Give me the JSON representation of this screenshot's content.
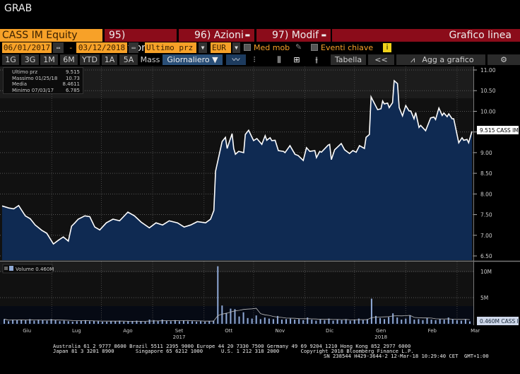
{
  "window_title": "GRAB",
  "toolbar": {
    "security": "CASS IM Equity",
    "compare": "95) Confronto",
    "actions": "96) Azioni",
    "edit": "97) Modif",
    "chart_type": "Grafico linea",
    "start_date": "06/01/2017",
    "date_sep": "-",
    "end_date": "03/12/2018",
    "field": "Ultimo prz",
    "currency": "EUR",
    "moving_avg": "Med mob",
    "key_events": "Eventi chiave",
    "info": "i",
    "periods": [
      "1G",
      "3G",
      "1M",
      "6M",
      "YTD",
      "1A",
      "5A",
      "Mass"
    ],
    "frequency": "Giornaliero ▼",
    "table": "Tabella",
    "collapse": "<<",
    "add_to_chart": "Agg a grafico"
  },
  "legend": {
    "last_label": "Ultimo prz",
    "last_value": "9.515",
    "max_label": "Massimo 01/25/18",
    "max_value": "10.73",
    "avg_label": "Media",
    "avg_value": "8.4611",
    "min_label": "Minimo 07/03/17",
    "min_value": "6.785",
    "volume_label": "Volume 0.460M"
  },
  "chart_data": {
    "type": "area",
    "x_unit": "days since 06/01/2017",
    "xlim": [
      0,
      284
    ],
    "price": {
      "ylim": [
        6.4,
        11.1
      ],
      "ticks": [
        "11.00",
        "10.50",
        "10.00",
        "9.50",
        "9.00",
        "8.50",
        "8.00",
        "7.50",
        "7.00",
        "6.50"
      ],
      "tick_values": [
        11,
        10.5,
        10,
        9.5,
        9,
        8.5,
        8,
        7.5,
        7,
        6.5
      ],
      "last_label": "9.515 CASS IM",
      "points": [
        [
          0,
          7.71
        ],
        [
          4,
          7.66
        ],
        [
          7,
          7.64
        ],
        [
          10,
          7.72
        ],
        [
          14,
          7.47
        ],
        [
          17,
          7.4
        ],
        [
          20,
          7.25
        ],
        [
          24,
          7.12
        ],
        [
          27,
          7.05
        ],
        [
          29,
          6.92
        ],
        [
          31,
          6.79
        ],
        [
          34,
          6.88
        ],
        [
          37,
          6.96
        ],
        [
          40,
          6.86
        ],
        [
          42,
          7.22
        ],
        [
          44,
          7.3
        ],
        [
          46,
          7.39
        ],
        [
          50,
          7.47
        ],
        [
          53,
          7.45
        ],
        [
          56,
          7.2
        ],
        [
          59,
          7.13
        ],
        [
          63,
          7.3
        ],
        [
          67,
          7.39
        ],
        [
          71,
          7.35
        ],
        [
          76,
          7.56
        ],
        [
          80,
          7.47
        ],
        [
          84,
          7.32
        ],
        [
          89,
          7.18
        ],
        [
          93,
          7.3
        ],
        [
          97,
          7.25
        ],
        [
          101,
          7.35
        ],
        [
          106,
          7.3
        ],
        [
          110,
          7.2
        ],
        [
          114,
          7.25
        ],
        [
          118,
          7.33
        ],
        [
          123,
          7.3
        ],
        [
          126,
          7.39
        ],
        [
          128,
          7.6
        ],
        [
          129,
          8.55
        ],
        [
          133,
          9.27
        ],
        [
          135,
          9.37
        ],
        [
          136,
          9.1
        ],
        [
          139,
          9.46
        ],
        [
          140,
          9.1
        ],
        [
          141,
          8.96
        ],
        [
          143,
          9.03
        ],
        [
          146,
          9.0
        ],
        [
          147,
          9.44
        ],
        [
          149,
          9.54
        ],
        [
          152,
          9.29
        ],
        [
          154,
          9.34
        ],
        [
          157,
          9.2
        ],
        [
          159,
          9.41
        ],
        [
          160,
          9.3
        ],
        [
          162,
          9.36
        ],
        [
          163,
          9.29
        ],
        [
          165,
          9.3
        ],
        [
          167,
          9.05
        ],
        [
          170,
          9.03
        ],
        [
          171,
          9.0
        ],
        [
          174,
          9.17
        ],
        [
          177,
          8.96
        ],
        [
          179,
          8.93
        ],
        [
          182,
          8.81
        ],
        [
          184,
          9.12
        ],
        [
          186,
          9.03
        ],
        [
          189,
          9.05
        ],
        [
          190,
          8.88
        ],
        [
          192,
          9.03
        ],
        [
          193,
          9.01
        ],
        [
          197,
          9.18
        ],
        [
          198,
          9.2
        ],
        [
          199,
          8.83
        ],
        [
          201,
          9.07
        ],
        [
          205,
          9.22
        ],
        [
          207,
          9.07
        ],
        [
          210,
          8.98
        ],
        [
          212,
          9.05
        ],
        [
          214,
          9.01
        ],
        [
          216,
          9.17
        ],
        [
          219,
          9.1
        ],
        [
          220,
          9.37
        ],
        [
          222,
          9.44
        ],
        [
          223,
          10.35
        ],
        [
          227,
          10.04
        ],
        [
          229,
          10.06
        ],
        [
          230,
          10.25
        ],
        [
          231,
          10.18
        ],
        [
          233,
          10.2
        ],
        [
          234,
          10.09
        ],
        [
          236,
          10.21
        ],
        [
          237,
          10.74
        ],
        [
          239,
          10.67
        ],
        [
          240,
          10.09
        ],
        [
          242,
          9.89
        ],
        [
          244,
          10.14
        ],
        [
          246,
          10.01
        ],
        [
          247,
          10.01
        ],
        [
          249,
          9.82
        ],
        [
          250,
          9.97
        ],
        [
          252,
          9.61
        ],
        [
          253,
          9.66
        ],
        [
          256,
          9.53
        ],
        [
          259,
          9.84
        ],
        [
          261,
          9.86
        ],
        [
          262,
          9.8
        ],
        [
          264,
          10.08
        ],
        [
          266,
          9.9
        ],
        [
          267,
          9.96
        ],
        [
          269,
          9.87
        ],
        [
          270,
          9.94
        ],
        [
          272,
          9.82
        ],
        [
          273,
          9.82
        ],
        [
          276,
          9.24
        ],
        [
          278,
          9.36
        ],
        [
          279,
          9.3
        ],
        [
          281,
          9.32
        ],
        [
          282,
          9.24
        ],
        [
          284,
          9.515
        ]
      ]
    },
    "volume": {
      "unit": "M",
      "ylim": [
        0,
        11.5
      ],
      "ticks": [
        "10M",
        "5M"
      ],
      "tick_values": [
        10,
        5
      ],
      "last_label": "0.460M CASS IM",
      "values": [
        0.9,
        0.5,
        0.8,
        0.7,
        0.8,
        0.7,
        0.9,
        0.6,
        0.8,
        0.7,
        0.6,
        0.9,
        0.7,
        0.5,
        0.6,
        0.5,
        0.4,
        0.5,
        0.6,
        0.7,
        0.5,
        0.6,
        0.5,
        0.4,
        0.4,
        0.5,
        0.5,
        0.6,
        0.4,
        0.5,
        0.5,
        0.6,
        0.5,
        0.4,
        0.8,
        0.7,
        0.6,
        0.8,
        0.6,
        0.5,
        0.7,
        0.5,
        0.6,
        0.5,
        0.5,
        0.4,
        0.5,
        0.4,
        0.5,
        0.6,
        11.0,
        3.5,
        2.1,
        2.9,
        2.8,
        1.4,
        2.2,
        1.1,
        1.0,
        1.6,
        0.9,
        1.2,
        1.0,
        0.9,
        1.5,
        0.8,
        0.9,
        1.0,
        0.8,
        0.9,
        0.7,
        1.2,
        0.8,
        0.6,
        0.9,
        0.7,
        1.0,
        0.6,
        0.8,
        0.7,
        0.9,
        0.6,
        0.8,
        1.0,
        0.7,
        0.9,
        4.8,
        1.5,
        1.1,
        0.9,
        1.3,
        2.0,
        1.2,
        0.8,
        1.0,
        1.6,
        0.8,
        0.9,
        0.7,
        1.1,
        0.8,
        0.7,
        0.9,
        0.8,
        1.2,
        0.9,
        0.7,
        0.6,
        0.9,
        0.46
      ]
    },
    "x_ticks": [
      {
        "label": "Giu",
        "day": 15
      },
      {
        "label": "Lug",
        "day": 45
      },
      {
        "label": "Ago",
        "day": 76
      },
      {
        "label": "Set",
        "day": 107,
        "year": "2017"
      },
      {
        "label": "Ott",
        "day": 137
      },
      {
        "label": "Nov",
        "day": 168
      },
      {
        "label": "Dic",
        "day": 198
      },
      {
        "label": "Gen",
        "day": 229,
        "year": "2018"
      },
      {
        "label": "Feb",
        "day": 260
      },
      {
        "label": "Mar",
        "day": 286
      }
    ],
    "colors": {
      "line": "#ffffff",
      "fill": "#0f2a52",
      "volume": "#8fa9d6"
    }
  },
  "footer": {
    "line1": "Australia 61 2 9777 8600 Brazil 5511 2395 9000 Europe 44 20 7330 7500 Germany 49 69 9204 1210 Hong Kong 852 2977 6000",
    "line2": "Japan 81 3 3201 8900       Singapore 65 6212 1000      U.S. 1 212 318 2000       Copyright 2018 Bloomberg Finance L.P.",
    "line3": "SN 238544 H429-3644-2 12-Mar-18 10:29:40 CET  GMT+1:00"
  }
}
